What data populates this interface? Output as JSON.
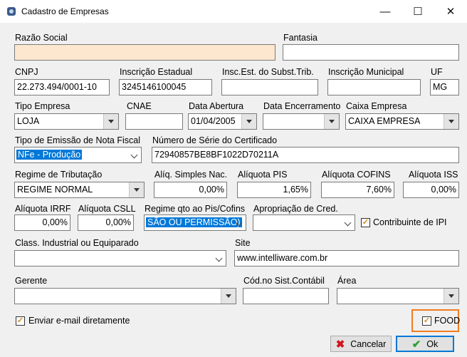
{
  "window": {
    "title": "Cadastro de Empresas",
    "minimize": "—",
    "maximize": "☐",
    "close": "✕"
  },
  "labels": {
    "razao_social": "Razão Social",
    "fantasia": "Fantasia",
    "cnpj": "CNPJ",
    "insc_estadual": "Inscrição Estadual",
    "insc_subst": "Insc.Est. do Subst.Trib.",
    "insc_municipal": "Inscrição Municipal",
    "uf": "UF",
    "tipo_empresa": "Tipo Empresa",
    "cnae": "CNAE",
    "data_abertura": "Data Abertura",
    "data_encerramento": "Data Encerramento",
    "caixa_empresa": "Caixa Empresa",
    "tipo_emissao": "Tipo de Emissão de Nota Fiscal",
    "numero_serie": "Número de Série do Certificado",
    "regime_tributacao": "Regime de Tributação",
    "aliq_simples": "Alíq. Simples Nac.",
    "aliq_pis": "Alíquota PIS",
    "aliq_cofins": "Alíquota COFINS",
    "aliq_iss": "Alíquota ISS",
    "aliq_irrf": "Alíquota IRRF",
    "aliq_csll": "Alíquota CSLL",
    "regime_pis": "Regime qto ao Pis/Cofins",
    "apropriacao": "Apropriação de Cred.",
    "contribuinte_ipi": "Contribuinte de IPI",
    "class_industrial": "Class. Industrial ou Equiparado",
    "site": "Site",
    "gerente": "Gerente",
    "cod_contabil": "Cód.no Sist.Contábil",
    "area": "Área",
    "enviar_email": "Enviar e-mail diretamente",
    "food": "FOOD"
  },
  "values": {
    "razao_social": "",
    "fantasia": "",
    "cnpj": "22.273.494/0001-10",
    "insc_estadual": "3245146100045",
    "insc_subst": "",
    "insc_municipal": "",
    "uf": "MG",
    "tipo_empresa": "LOJA",
    "cnae": "",
    "data_abertura": "01/04/2005",
    "data_encerramento": "",
    "caixa_empresa": "CAIXA EMPRESA",
    "tipo_emissao": "NFe - Produção",
    "numero_serie": "72940857BE8BF1022D70211A",
    "regime_tributacao": "REGIME NORMAL",
    "aliq_simples": "0,00%",
    "aliq_pis": "1,65%",
    "aliq_cofins": "7,60%",
    "aliq_iss": "0,00%",
    "aliq_irrf": "0,00%",
    "aliq_csll": "0,00%",
    "regime_pis": "SÃO OU PERMISSÃO)",
    "apropriacao": "",
    "class_industrial": "",
    "site": "www.intelliware.com.br",
    "gerente": "",
    "cod_contabil": "",
    "area": ""
  },
  "checkboxes": {
    "contribuinte_ipi": true,
    "enviar_email": true,
    "food": true
  },
  "buttons": {
    "cancelar": "Cancelar",
    "ok": "Ok"
  },
  "colors": {
    "required_field_bg": "#fde7cf",
    "selection": "#0078d7",
    "highlight_border": "#f07c22",
    "check": "#d7861f"
  }
}
